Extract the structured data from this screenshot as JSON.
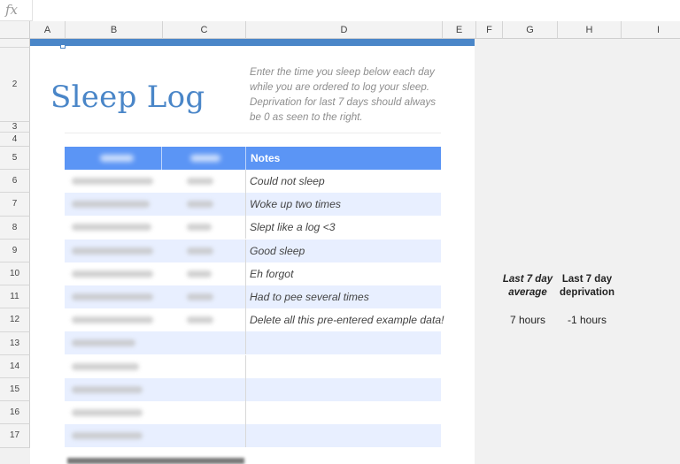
{
  "formula_bar": {
    "fx_label": "fx",
    "value": ""
  },
  "columns": [
    "A",
    "B",
    "C",
    "D",
    "E",
    "F",
    "G",
    "H",
    "I"
  ],
  "rows": [
    "2",
    "3",
    "4",
    "5",
    "6",
    "7",
    "8",
    "9",
    "10",
    "11",
    "12",
    "13",
    "14",
    "15",
    "16",
    "17"
  ],
  "sheet": {
    "title": "Sleep Log",
    "instructions": "Enter the time you sleep below each day while you are ordered to log your sleep. Deprivation for last 7 days should always be 0 as seen to the right."
  },
  "table": {
    "headers": {
      "notes": "Notes"
    },
    "notes": [
      "Could not sleep",
      "Woke up two times",
      "Slept like a log <3",
      "Good sleep",
      "Eh forgot",
      "Had to pee several times",
      "Delete all this pre-entered example data!",
      "",
      "",
      "",
      "",
      ""
    ]
  },
  "stats": {
    "average_label_line1": "Last 7 day",
    "average_label_line2": "average",
    "deprivation_label_line1": "Last 7 day",
    "deprivation_label_line2": "deprivation",
    "average_value": "7 hours",
    "deprivation_value": "-1 hours"
  },
  "colors": {
    "accent": "#4a86c8",
    "header_blue": "#5b95f5",
    "band": "#e8efff"
  }
}
